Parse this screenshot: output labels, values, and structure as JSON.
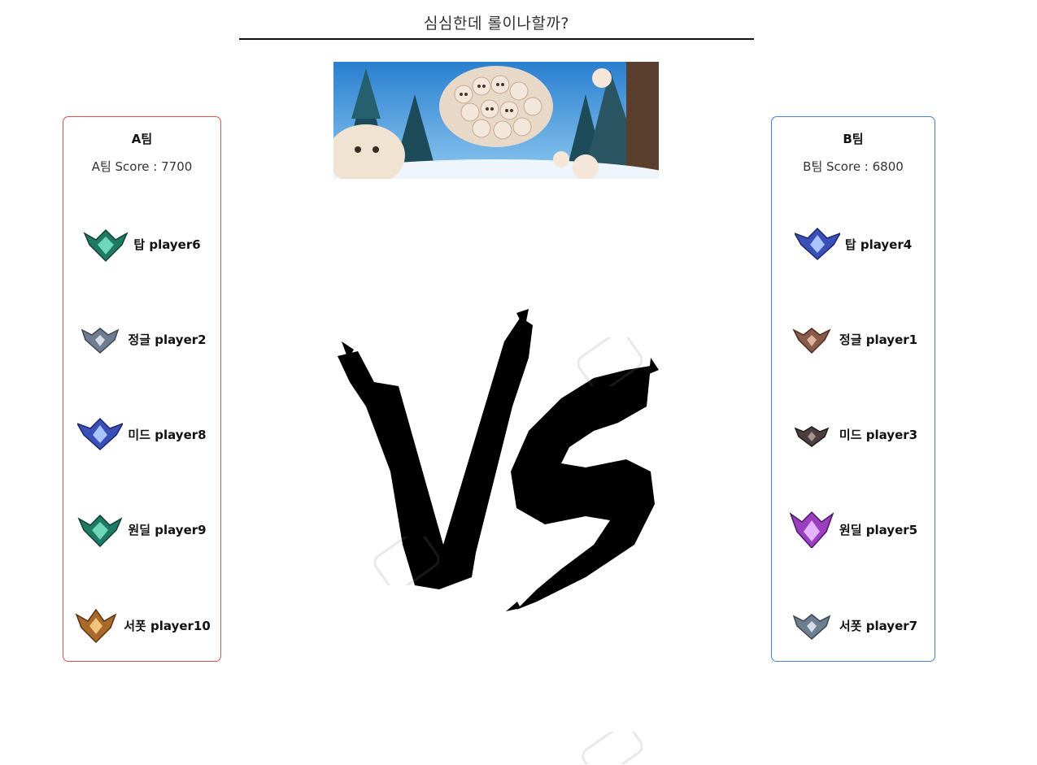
{
  "page": {
    "title": "심심한데 롤이나할까?",
    "vs_text": "VS"
  },
  "teams": [
    {
      "name": "A팀",
      "score_label": "A팀 Score : 7700",
      "border_color": "#d9534f",
      "players": [
        {
          "position": "탑",
          "name": "player6",
          "tier_icon": "emerald-emblem-icon"
        },
        {
          "position": "정글",
          "name": "player2",
          "tier_icon": "silver-emblem-icon"
        },
        {
          "position": "미드",
          "name": "player8",
          "tier_icon": "diamond-emblem-icon"
        },
        {
          "position": "원딜",
          "name": "player9",
          "tier_icon": "emerald-emblem-icon"
        },
        {
          "position": "서폿",
          "name": "player10",
          "tier_icon": "gold-emblem-icon"
        }
      ]
    },
    {
      "name": "B팀",
      "score_label": "B팀 Score : 6800",
      "border_color": "#4a7fd8",
      "players": [
        {
          "position": "탑",
          "name": "player4",
          "tier_icon": "diamond-emblem-icon"
        },
        {
          "position": "정글",
          "name": "player1",
          "tier_icon": "bronze-emblem-icon"
        },
        {
          "position": "미드",
          "name": "player3",
          "tier_icon": "iron-emblem-icon"
        },
        {
          "position": "원딜",
          "name": "player5",
          "tier_icon": "master-emblem-icon"
        },
        {
          "position": "서폿",
          "name": "player7",
          "tier_icon": "silver-emblem-icon"
        }
      ]
    }
  ],
  "tier_colors": {
    "emerald": "#1f7a64",
    "silver": "#6f7d90",
    "diamond": "#3a4fb8",
    "gold": "#a8692b",
    "bronze": "#8a5a4a",
    "iron": "#4a3f3d",
    "master": "#9a3fc0"
  }
}
